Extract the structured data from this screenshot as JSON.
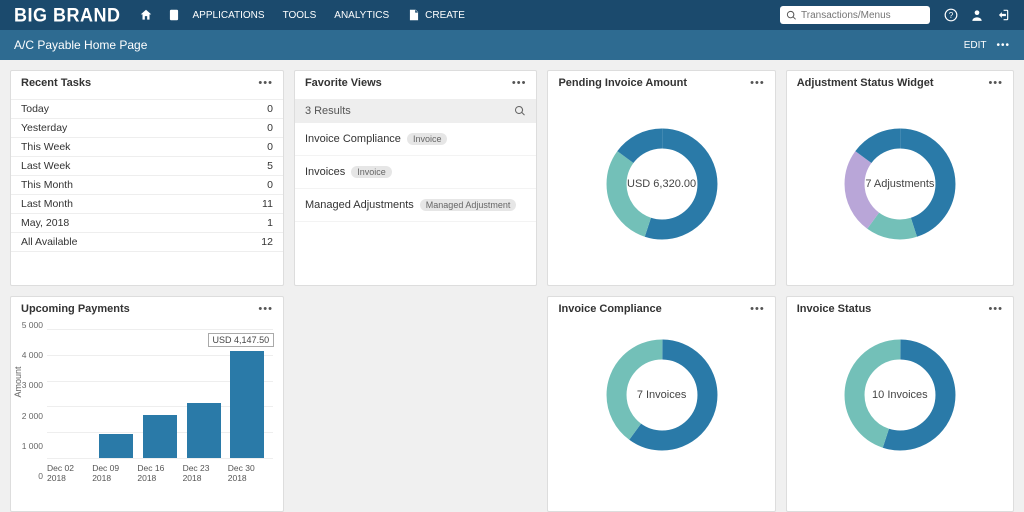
{
  "brand": "BIG BRAND",
  "nav": {
    "applications": "APPLICATIONS",
    "tools": "TOOLS",
    "analytics": "ANALYTICS",
    "create": "CREATE"
  },
  "search": {
    "placeholder": "Transactions/Menus"
  },
  "page_title": "A/C Payable Home Page",
  "edit_label": "EDIT",
  "cards": {
    "recent_tasks": {
      "title": "Recent Tasks",
      "rows": [
        {
          "label": "Today",
          "count": 0
        },
        {
          "label": "Yesterday",
          "count": 0
        },
        {
          "label": "This Week",
          "count": 0
        },
        {
          "label": "Last Week",
          "count": 5
        },
        {
          "label": "This Month",
          "count": 0
        },
        {
          "label": "Last Month",
          "count": 11
        },
        {
          "label": "May, 2018",
          "count": 1
        },
        {
          "label": "All Available",
          "count": 12
        }
      ]
    },
    "favorite_views": {
      "title": "Favorite Views",
      "results_label": "3 Results",
      "items": [
        {
          "label": "Invoice Compliance",
          "tag": "Invoice"
        },
        {
          "label": "Invoices",
          "tag": "Invoice"
        },
        {
          "label": "Managed Adjustments",
          "tag": "Managed Adjustment"
        }
      ]
    },
    "pending_invoice": {
      "title": "Pending Invoice Amount",
      "center": "USD 6,320.00"
    },
    "adjustment_status": {
      "title": "Adjustment Status Widget",
      "center": "7 Adjustments"
    },
    "invoice_compliance": {
      "title": "Invoice Compliance",
      "center": "7 Invoices"
    },
    "invoice_status": {
      "title": "Invoice Status",
      "center": "10 Invoices"
    },
    "upcoming_payments": {
      "title": "Upcoming Payments",
      "tooltip": "USD 4,147.50"
    }
  },
  "chart_data": [
    {
      "id": "upcoming_payments",
      "type": "bar",
      "categories": [
        "Dec 02 2018",
        "Dec 09 2018",
        "Dec 16 2018",
        "Dec 23 2018",
        "Dec 30 2018"
      ],
      "values": [
        0,
        950,
        1650,
        2150,
        4147.5
      ],
      "ylabel": "Amount",
      "yticks": [
        0,
        1000,
        2000,
        3000,
        4000,
        5000
      ],
      "ytick_labels": [
        "0",
        "1 000",
        "2 000",
        "3 000",
        "4 000",
        "5 000"
      ],
      "ylim": [
        0,
        5000
      ]
    },
    {
      "id": "pending_invoice",
      "type": "donut",
      "series": [
        {
          "name": "seg1",
          "value": 55,
          "color": "#2a7aa8"
        },
        {
          "name": "seg2",
          "value": 30,
          "color": "#73c0b8"
        },
        {
          "name": "seg3",
          "value": 15,
          "color": "#2a7aa8"
        }
      ],
      "center_label": "USD 6,320.00"
    },
    {
      "id": "adjustment_status",
      "type": "donut",
      "series": [
        {
          "name": "seg1",
          "value": 45,
          "color": "#2a7aa8"
        },
        {
          "name": "seg2",
          "value": 15,
          "color": "#73c0b8"
        },
        {
          "name": "seg3",
          "value": 25,
          "color": "#b9a6d8"
        },
        {
          "name": "seg4",
          "value": 15,
          "color": "#2a7aa8"
        }
      ],
      "center_label": "7 Adjustments"
    },
    {
      "id": "invoice_compliance",
      "type": "donut",
      "series": [
        {
          "name": "seg1",
          "value": 60,
          "color": "#2a7aa8"
        },
        {
          "name": "seg2",
          "value": 40,
          "color": "#73c0b8"
        }
      ],
      "center_label": "7 Invoices"
    },
    {
      "id": "invoice_status",
      "type": "donut",
      "series": [
        {
          "name": "seg1",
          "value": 55,
          "color": "#2a7aa8"
        },
        {
          "name": "seg2",
          "value": 45,
          "color": "#73c0b8"
        }
      ],
      "center_label": "10 Invoices"
    }
  ]
}
